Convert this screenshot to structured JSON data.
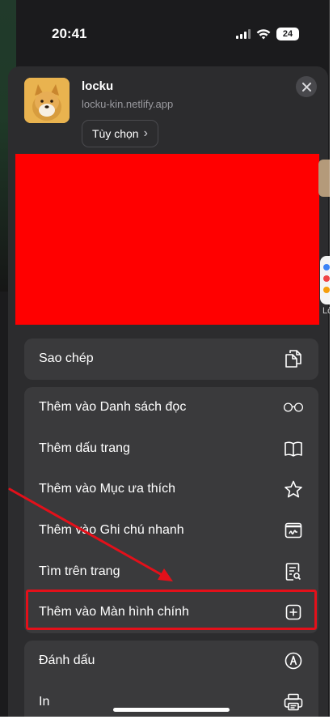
{
  "status_bar": {
    "time": "20:41",
    "battery": "24"
  },
  "site": {
    "name": "locku",
    "url": "locku-kin.netlify.app",
    "options_label": "Tùy chọn",
    "options_chevron": "›"
  },
  "side_peek": {
    "label": "Lờ"
  },
  "actions": {
    "group1": [
      {
        "label": "Sao chép",
        "icon": "copy-icon"
      }
    ],
    "group2": [
      {
        "label": "Thêm vào Danh sách đọc",
        "icon": "glasses-icon"
      },
      {
        "label": "Thêm dấu trang",
        "icon": "book-icon"
      },
      {
        "label": "Thêm vào Mục ưa thích",
        "icon": "star-icon"
      },
      {
        "label": "Thêm vào Ghi chú nhanh",
        "icon": "quick-note-icon"
      },
      {
        "label": "Tìm trên trang",
        "icon": "find-in-page-icon"
      },
      {
        "label": "Thêm vào Màn hình chính",
        "icon": "add-square-icon"
      }
    ],
    "group3": [
      {
        "label": "Đánh dấu",
        "icon": "markup-icon"
      },
      {
        "label": "In",
        "icon": "printer-icon"
      }
    ]
  },
  "colors": {
    "annotation": "#e3101a",
    "redaction": "#ff0000",
    "sheet": "#2c2c2e",
    "row": "#3a3a3c"
  }
}
